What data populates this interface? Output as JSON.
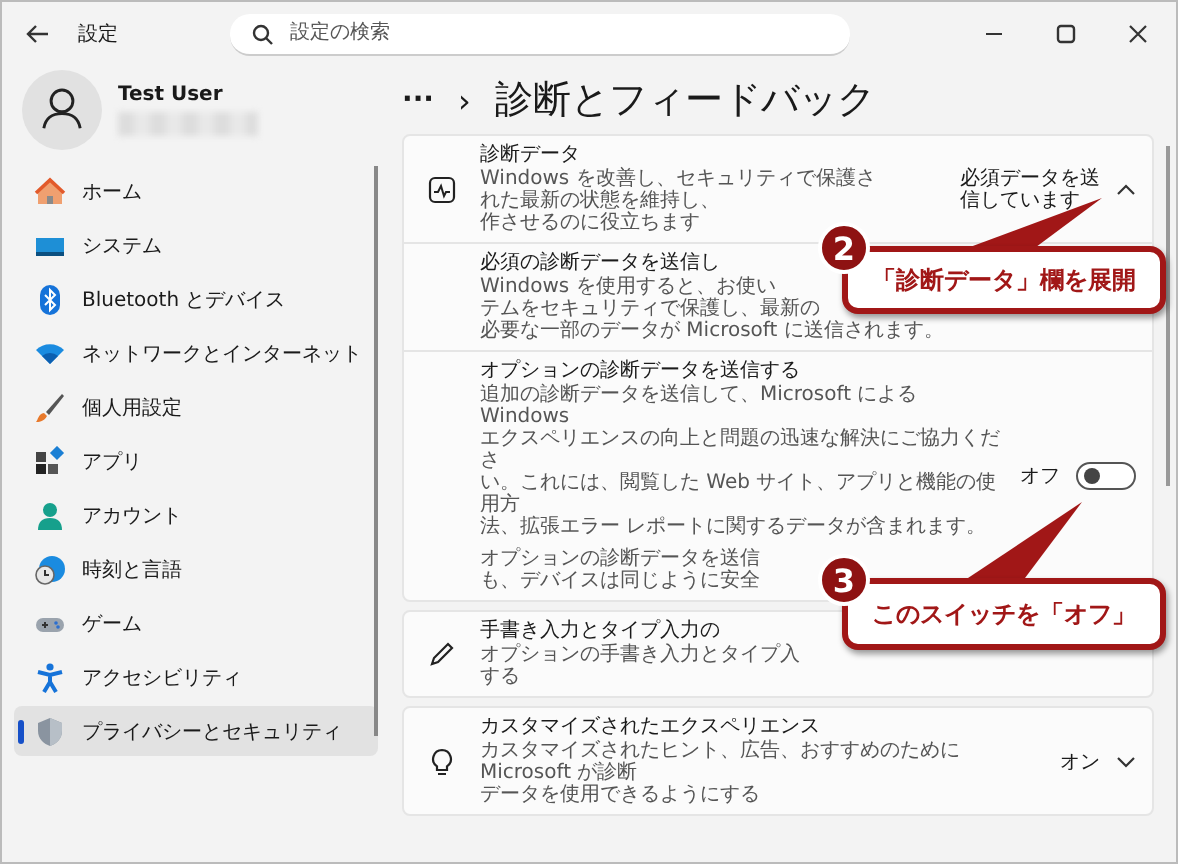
{
  "window": {
    "title": "設定"
  },
  "search": {
    "placeholder": "設定の検索"
  },
  "user": {
    "name": "Test User"
  },
  "sidebar": {
    "items": [
      {
        "label": "ホーム",
        "selected": false
      },
      {
        "label": "システム",
        "selected": false
      },
      {
        "label": "Bluetooth とデバイス",
        "selected": false
      },
      {
        "label": "ネットワークとインターネット",
        "selected": false
      },
      {
        "label": "個人用設定",
        "selected": false
      },
      {
        "label": "アプリ",
        "selected": false
      },
      {
        "label": "アカウント",
        "selected": false
      },
      {
        "label": "時刻と言語",
        "selected": false
      },
      {
        "label": "ゲーム",
        "selected": false
      },
      {
        "label": "アクセシビリティ",
        "selected": false
      },
      {
        "label": "プライバシーとセキュリティ",
        "selected": true
      }
    ]
  },
  "breadcrumb": {
    "more": "···",
    "separator": "›",
    "title": "診断とフィードバック"
  },
  "cards": [
    {
      "title": "診断データ",
      "lines": [
        "Windows を改善し、セキュリティで保護さ",
        "れた最新の状態を維持し、",
        "作させるのに役立ちます"
      ],
      "value": "必須データを送信しています",
      "expanded": true,
      "children": [
        {
          "kind": "text",
          "title": "必須の診断データを送信し",
          "lines": [
            "Windows を使用すると、お使い",
            "テムをセキュリティで保護し、最新の",
            "必要な一部のデータが Microsoft に送信されます。"
          ]
        },
        {
          "kind": "toggle",
          "title": "オプションの診断データを送信する",
          "lines": [
            "追加の診断データを送信して、Microsoft による Windows",
            "エクスペリエンスの向上と問題の迅速な解決にご協力くださ",
            "い。これには、閲覧した Web サイト、アプリと機能の使用方",
            "法、拡張エラー レポートに関するデータが含まれます。"
          ],
          "note": [
            "オプションの診断データを送信",
            "も、デバイスは同じように安全"
          ],
          "state_label": "オフ",
          "on": false
        }
      ]
    },
    {
      "title": "手書き入力とタイプ入力の",
      "lines": [
        "オプションの手書き入力とタイプ入",
        "する"
      ]
    },
    {
      "title": "カスタマイズされたエクスペリエンス",
      "lines": [
        "カスタマイズされたヒント、広告、おすすめのために Microsoft が診断",
        "データを使用できるようにする"
      ],
      "value": "オン",
      "expanded": false
    }
  ],
  "callouts": [
    {
      "number": "2",
      "text": "「診断データ」欄を展開"
    },
    {
      "number": "3",
      "text": "このスイッチを「オフ」"
    }
  ]
}
